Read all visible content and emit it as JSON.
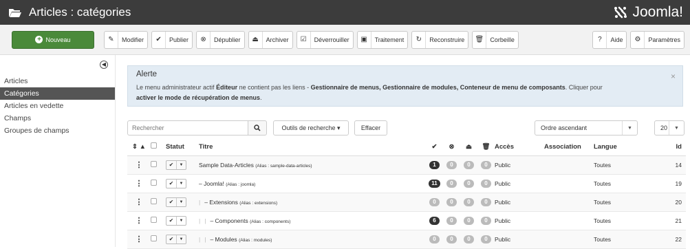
{
  "header": {
    "title": "Articles : catégories",
    "brand": "Joomla!"
  },
  "toolbar": {
    "new": "Nouveau",
    "edit": "Modifier",
    "publish": "Publier",
    "unpublish": "Dépublier",
    "archive": "Archiver",
    "checkin": "Déverrouiller",
    "batch": "Traitement",
    "rebuild": "Reconstruire",
    "trash": "Corbeille",
    "help": "Aide",
    "options": "Paramètres"
  },
  "sidebar": {
    "items": [
      "Articles",
      "Catégories",
      "Articles en vedette",
      "Champs",
      "Groupes de champs"
    ]
  },
  "alert": {
    "title": "Alerte",
    "text1": "Le menu administrateur actif ",
    "menu": "Éditeur",
    "text2": " ne contient pas les liens - ",
    "links": "Gestionnaire de menus, Gestionnaire de modules, Conteneur de menu de composants",
    "text3": ". Cliquer pour",
    "recovery": "activer le mode de récupération de menus",
    "text4": "."
  },
  "filters": {
    "search_placeholder": "Rechercher",
    "search_tools": "Outils de recherche",
    "clear": "Effacer",
    "ordering": "Ordre ascendant",
    "limit": "20"
  },
  "table": {
    "headers": {
      "sort": "⇕ ▲",
      "status": "Statut",
      "title": "Titre",
      "access": "Accès",
      "association": "Association",
      "language": "Langue",
      "id": "Id"
    },
    "rows": [
      {
        "title": "Sample Data-Articles",
        "alias": "(Alias : sample-data-articles)",
        "prefix": "",
        "published": "1",
        "unpublished": "0",
        "archived": "0",
        "trashed": "0",
        "access": "Public",
        "language": "Toutes",
        "id": "14"
      },
      {
        "title": "Joomla!",
        "alias": "(Alias : joomla)",
        "prefix": "–",
        "published": "11",
        "unpublished": "0",
        "archived": "0",
        "trashed": "0",
        "access": "Public",
        "language": "Toutes",
        "id": "19"
      },
      {
        "title": "Extensions",
        "alias": "(Alias : extensions)",
        "prefix": "–",
        "published": "0",
        "unpublished": "0",
        "archived": "0",
        "trashed": "0",
        "access": "Public",
        "language": "Toutes",
        "id": "20"
      },
      {
        "title": "Components",
        "alias": "(Alias : components)",
        "prefix": "–",
        "published": "6",
        "unpublished": "0",
        "archived": "0",
        "trashed": "0",
        "access": "Public",
        "language": "Toutes",
        "id": "21"
      },
      {
        "title": "Modules",
        "alias": "(Alias : modules)",
        "prefix": "–",
        "published": "0",
        "unpublished": "0",
        "archived": "0",
        "trashed": "0",
        "access": "Public",
        "language": "Toutes",
        "id": "22"
      }
    ]
  }
}
